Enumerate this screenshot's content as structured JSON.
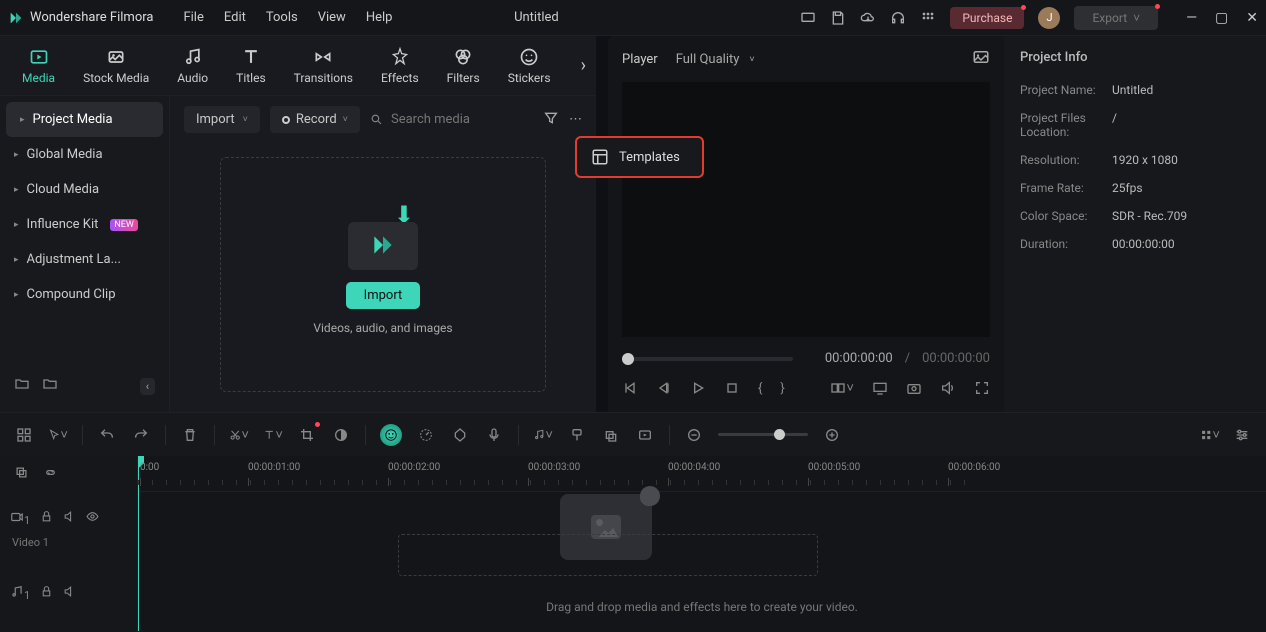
{
  "app": {
    "name": "Wondershare Filmora",
    "title": "Untitled"
  },
  "menu": [
    "File",
    "Edit",
    "Tools",
    "View",
    "Help"
  ],
  "titlebar": {
    "purchase": "Purchase",
    "avatar_initial": "J",
    "export": "Export"
  },
  "tabs": [
    {
      "label": "Media",
      "active": true
    },
    {
      "label": "Stock Media"
    },
    {
      "label": "Audio"
    },
    {
      "label": "Titles"
    },
    {
      "label": "Transitions"
    },
    {
      "label": "Effects"
    },
    {
      "label": "Filters"
    },
    {
      "label": "Stickers"
    }
  ],
  "sidebar": {
    "items": [
      {
        "label": "Project Media",
        "active": true
      },
      {
        "label": "Global Media"
      },
      {
        "label": "Cloud Media"
      },
      {
        "label": "Influence Kit",
        "badge": "NEW"
      },
      {
        "label": "Adjustment La..."
      },
      {
        "label": "Compound Clip"
      }
    ]
  },
  "mediatoolbar": {
    "import": "Import",
    "record": "Record",
    "search_placeholder": "Search media"
  },
  "dropzone": {
    "import_btn": "Import",
    "hint": "Videos, audio, and images"
  },
  "templates_button": "Templates",
  "preview": {
    "player_label": "Player",
    "quality": "Full Quality",
    "current_time": "00:00:00:00",
    "total_time": "00:00:00:00"
  },
  "info": {
    "title": "Project Info",
    "rows": [
      {
        "k": "Project Name:",
        "v": "Untitled"
      },
      {
        "k": "Project Files Location:",
        "v": "/"
      },
      {
        "k": "Resolution:",
        "v": "1920 x 1080"
      },
      {
        "k": "Frame Rate:",
        "v": "25fps"
      },
      {
        "k": "Color Space:",
        "v": "SDR - Rec.709"
      },
      {
        "k": "Duration:",
        "v": "00:00:00:00"
      }
    ]
  },
  "timeline": {
    "ticks": [
      "0:00",
      "00:00:01:00",
      "00:00:02:00",
      "00:00:03:00",
      "00:00:04:00",
      "00:00:05:00",
      "00:00:06:00"
    ],
    "video_track": "Video 1",
    "hint": "Drag and drop media and effects here to create your video."
  }
}
